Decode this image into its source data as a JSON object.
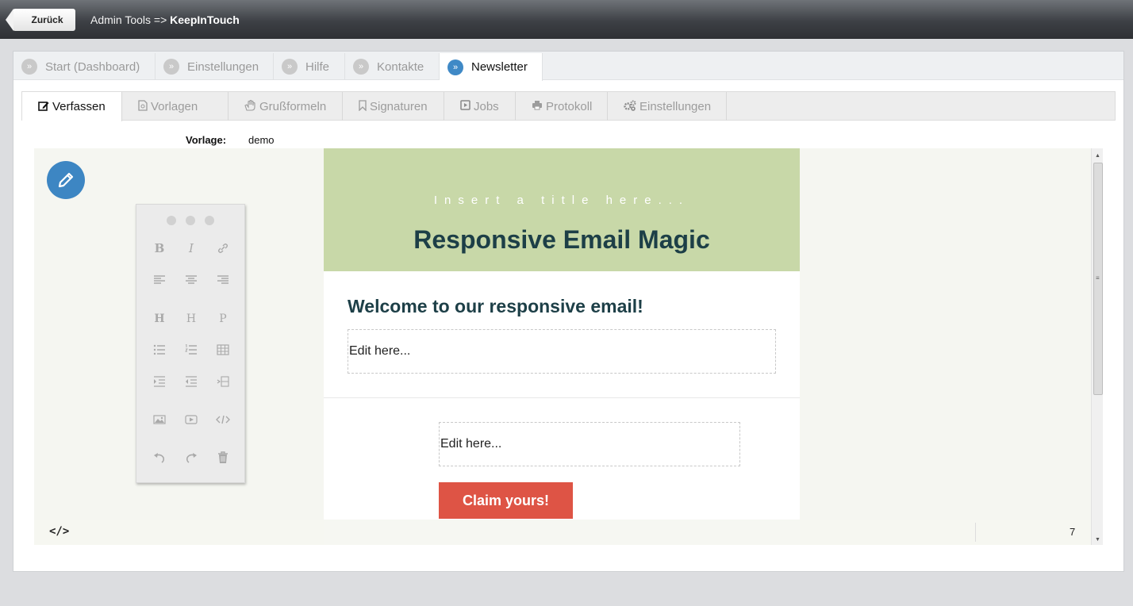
{
  "topbar": {
    "back_label": "Zurück",
    "breadcrumb_prefix": "Admin Tools =>",
    "breadcrumb_current": "KeepInTouch"
  },
  "main_tabs": [
    {
      "label": "Start (Dashboard)",
      "active": false
    },
    {
      "label": "Einstellungen",
      "active": false
    },
    {
      "label": "Hilfe",
      "active": false
    },
    {
      "label": "Kontakte",
      "active": false
    },
    {
      "label": "Newsletter",
      "active": true
    }
  ],
  "bullet_glyph": "»",
  "sub_tabs": [
    {
      "label": "Verfassen",
      "icon": "edit-icon",
      "active": true
    },
    {
      "label": "Vorlagen",
      "icon": "file-icon",
      "active": false
    },
    {
      "label": "Grußformeln",
      "icon": "hand-icon",
      "active": false
    },
    {
      "label": "Signaturen",
      "icon": "bookmark-icon",
      "active": false
    },
    {
      "label": "Jobs",
      "icon": "play-icon",
      "active": false
    },
    {
      "label": "Protokoll",
      "icon": "print-icon",
      "active": false
    },
    {
      "label": "Einstellungen",
      "icon": "cogs-icon",
      "active": false
    }
  ],
  "template": {
    "label": "Vorlage:",
    "value": "demo"
  },
  "email": {
    "hero_subtitle": "Insert a title here...",
    "hero_title": "Responsive Email Magic",
    "hero_color": "#c8d8a8",
    "welcome_heading": "Welcome to our responsive email!",
    "edit_block_1": "Edit here...",
    "edit_block_2": "Edit here...",
    "cta_label": "Claim yours!",
    "cta_color": "#de5445"
  },
  "statusbar": {
    "code_label": "</>",
    "count": "7"
  },
  "colors": {
    "accent": "#3d86c3"
  }
}
